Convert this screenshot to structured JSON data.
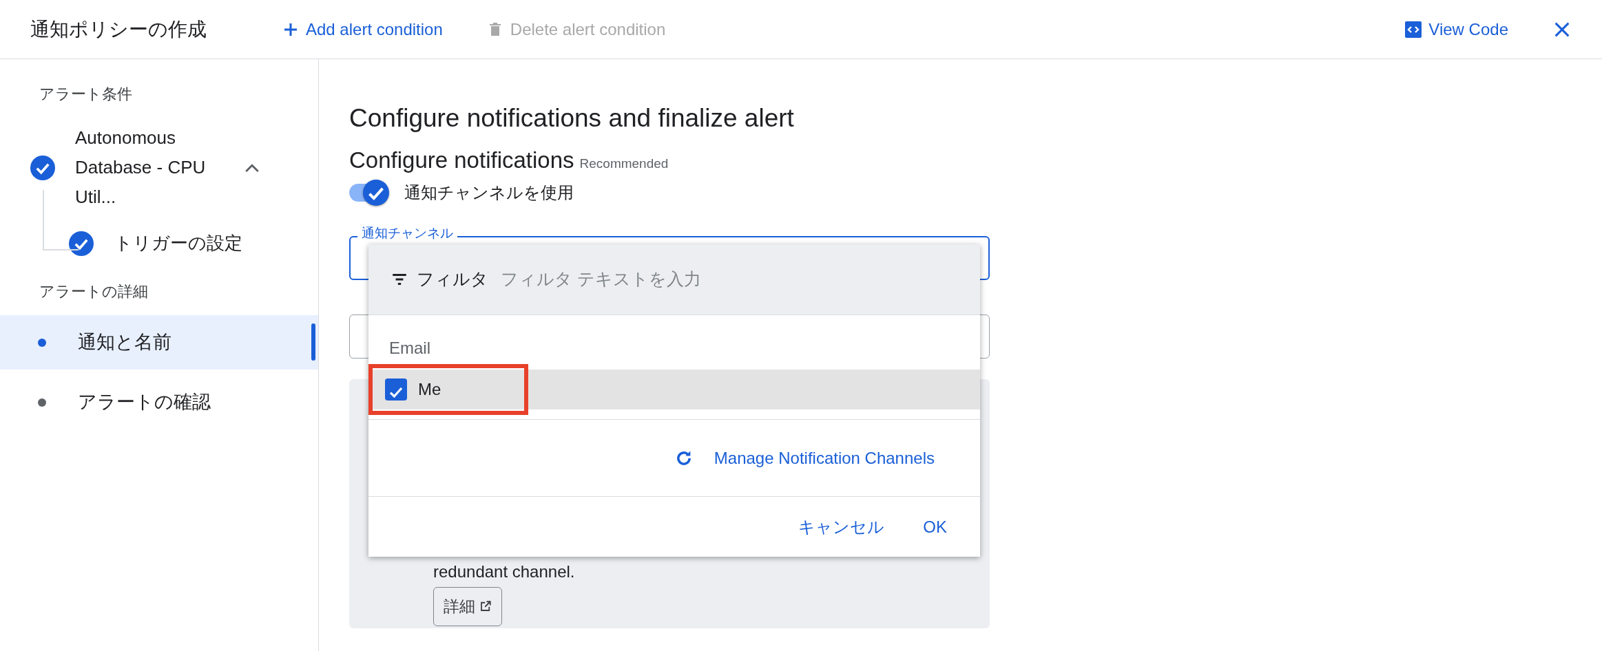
{
  "header": {
    "title": "通知ポリシーの作成",
    "actions": [
      {
        "label": "Add alert condition",
        "kind": "add",
        "disabled": false
      },
      {
        "label": "Delete alert condition",
        "kind": "delete",
        "disabled": true
      }
    ],
    "view_code": "View Code"
  },
  "sidebar": {
    "sections": [
      {
        "heading": "アラート条件",
        "items": [
          {
            "label": "Autonomous Database - CPU Util...",
            "kind": "step",
            "done": true,
            "expanded": true,
            "children": [
              {
                "label": "トリガーの設定",
                "kind": "step",
                "done": true
              }
            ]
          }
        ]
      },
      {
        "heading": "アラートの詳細",
        "items": [
          {
            "label": "通知と名前",
            "kind": "dot",
            "selected": true
          },
          {
            "label": "アラートの確認",
            "kind": "dot",
            "selected": false
          }
        ]
      }
    ]
  },
  "main": {
    "title": "Configure notifications and finalize alert",
    "section_title": "Configure notifications",
    "section_badge": "Recommended",
    "toggle": {
      "label": "通知チャンネルを使用",
      "on": true
    },
    "channel_field": {
      "label": "通知チャンネル"
    },
    "info_text": "redundant channel.",
    "info_button": "詳細"
  },
  "dropdown": {
    "filter_label": "フィルタ",
    "filter_placeholder": "フィルタ テキストを入力",
    "group": "Email",
    "options": [
      {
        "label": "Me",
        "checked": true,
        "highlighted": true
      }
    ],
    "manage_link": "Manage Notification Channels",
    "buttons": [
      "キャンセル",
      "OK"
    ]
  }
}
